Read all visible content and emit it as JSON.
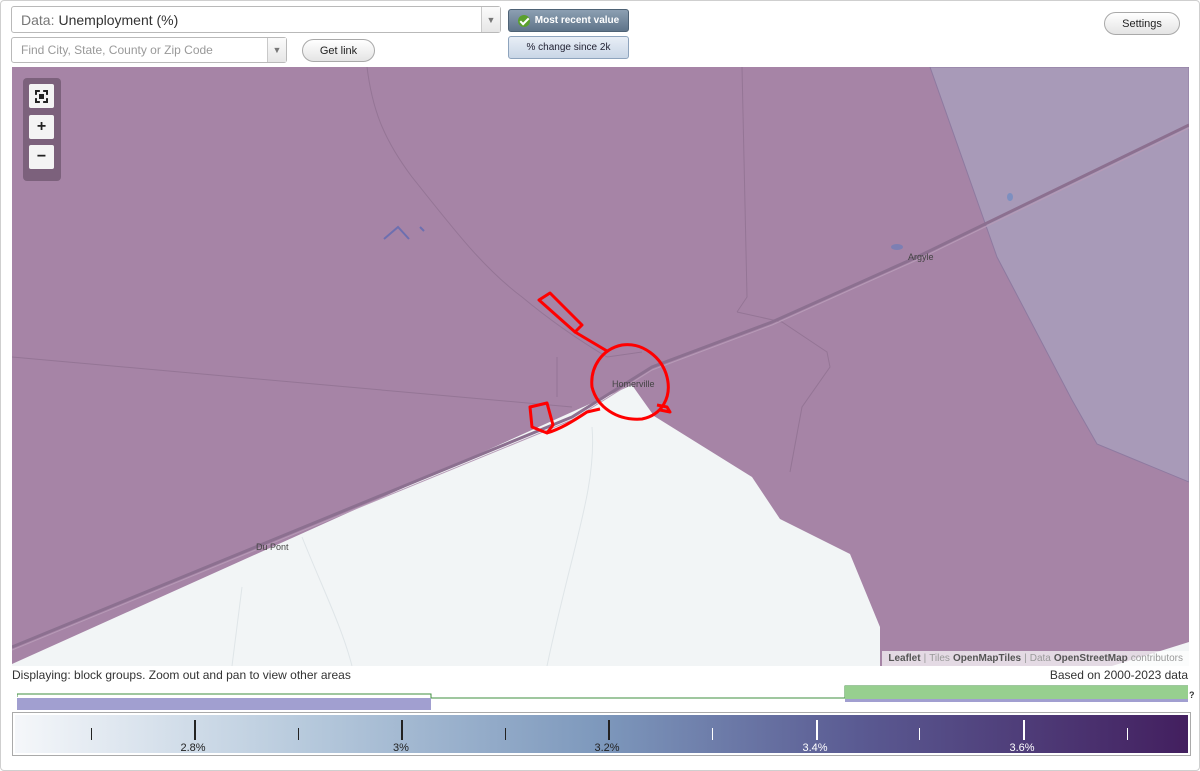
{
  "toolbar": {
    "data_prefix": "Data:",
    "data_value": "Unemployment (%)",
    "search_placeholder": "Find City, State, County or Zip Code",
    "get_link": "Get link",
    "most_recent": "Most recent value",
    "pct_change": "% change since 2k",
    "settings": "Settings"
  },
  "map": {
    "places": [
      "Argyle",
      "Homerville",
      "Du Pont"
    ],
    "attribution": {
      "leaflet": "Leaflet",
      "sep1": "|",
      "tiles_label": "Tiles",
      "tiles_source": "OpenMapTiles",
      "sep2": "|",
      "data_label": "Data",
      "data_source": "OpenStreetMap",
      "contributors": "contributors"
    },
    "colors": {
      "fill_main": "#a684a6",
      "fill_east": "#a89ab8",
      "no_data": "#f2f5f6",
      "highlight": "#ff0000"
    }
  },
  "footer": {
    "displaying": "Displaying: block groups. Zoom out and pan to view other areas",
    "based_on": "Based on 2000-2023 data",
    "help": "?"
  },
  "legend": {
    "labels": [
      "2.8%",
      "3%",
      "3.2%",
      "3.4%",
      "3.6%"
    ]
  }
}
